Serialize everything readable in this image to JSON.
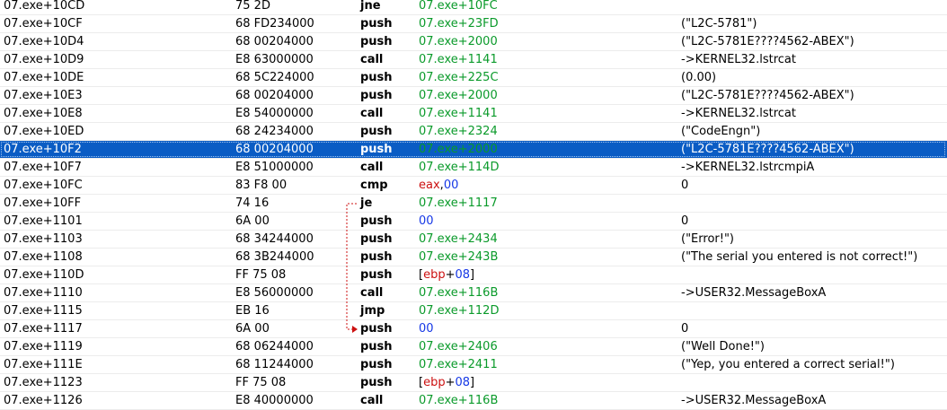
{
  "disassembly": {
    "rows": [
      {
        "addr": "07.exe+10CD",
        "bytes": "75 2D",
        "mnemonic": "jne",
        "operand": [
          {
            "text": "07.exe+10FC",
            "color": "green"
          }
        ],
        "comment": "",
        "selected": false
      },
      {
        "addr": "07.exe+10CF",
        "bytes": "68 FD234000",
        "mnemonic": "push",
        "operand": [
          {
            "text": "07.exe+23FD",
            "color": "green"
          }
        ],
        "comment": "(\"L2C-5781\")",
        "selected": false
      },
      {
        "addr": "07.exe+10D4",
        "bytes": "68 00204000",
        "mnemonic": "push",
        "operand": [
          {
            "text": "07.exe+2000",
            "color": "green"
          }
        ],
        "comment": "(\"L2C-5781E????4562-ABEX\")",
        "selected": false
      },
      {
        "addr": "07.exe+10D9",
        "bytes": "E8 63000000",
        "mnemonic": "call",
        "operand": [
          {
            "text": "07.exe+1141",
            "color": "green"
          }
        ],
        "comment": "->KERNEL32.lstrcat",
        "selected": false
      },
      {
        "addr": "07.exe+10DE",
        "bytes": "68 5C224000",
        "mnemonic": "push",
        "operand": [
          {
            "text": "07.exe+225C",
            "color": "green"
          }
        ],
        "comment": "(0.00)",
        "selected": false
      },
      {
        "addr": "07.exe+10E3",
        "bytes": "68 00204000",
        "mnemonic": "push",
        "operand": [
          {
            "text": "07.exe+2000",
            "color": "green"
          }
        ],
        "comment": "(\"L2C-5781E????4562-ABEX\")",
        "selected": false
      },
      {
        "addr": "07.exe+10E8",
        "bytes": "E8 54000000",
        "mnemonic": "call",
        "operand": [
          {
            "text": "07.exe+1141",
            "color": "green"
          }
        ],
        "comment": "->KERNEL32.lstrcat",
        "selected": false
      },
      {
        "addr": "07.exe+10ED",
        "bytes": "68 24234000",
        "mnemonic": "push",
        "operand": [
          {
            "text": "07.exe+2324",
            "color": "green"
          }
        ],
        "comment": "(\"CodeEngn\")",
        "selected": false
      },
      {
        "addr": "07.exe+10F2",
        "bytes": "68 00204000",
        "mnemonic": "push",
        "operand": [
          {
            "text": "07.exe+2000",
            "color": "green"
          }
        ],
        "comment": "(\"L2C-5781E????4562-ABEX\")",
        "selected": true
      },
      {
        "addr": "07.exe+10F7",
        "bytes": "E8 51000000",
        "mnemonic": "call",
        "operand": [
          {
            "text": "07.exe+114D",
            "color": "green"
          }
        ],
        "comment": "->KERNEL32.lstrcmpiA",
        "selected": false
      },
      {
        "addr": "07.exe+10FC",
        "bytes": "83 F8 00",
        "mnemonic": "cmp",
        "operand": [
          {
            "text": "eax",
            "color": "red"
          },
          {
            "text": ",",
            "color": "black"
          },
          {
            "text": "00",
            "color": "blue"
          }
        ],
        "comment": "0",
        "selected": false
      },
      {
        "addr": "07.exe+10FF",
        "bytes": "74 16",
        "mnemonic": "je",
        "operand": [
          {
            "text": "07.exe+1117",
            "color": "green"
          }
        ],
        "comment": "",
        "selected": false
      },
      {
        "addr": "07.exe+1101",
        "bytes": "6A 00",
        "mnemonic": "push",
        "operand": [
          {
            "text": "00",
            "color": "blue"
          }
        ],
        "comment": "0",
        "selected": false
      },
      {
        "addr": "07.exe+1103",
        "bytes": "68 34244000",
        "mnemonic": "push",
        "operand": [
          {
            "text": "07.exe+2434",
            "color": "green"
          }
        ],
        "comment": "(\"Error!\")",
        "selected": false
      },
      {
        "addr": "07.exe+1108",
        "bytes": "68 3B244000",
        "mnemonic": "push",
        "operand": [
          {
            "text": "07.exe+243B",
            "color": "green"
          }
        ],
        "comment": "(\"The serial you entered is not correct!\")",
        "selected": false
      },
      {
        "addr": "07.exe+110D",
        "bytes": "FF 75 08",
        "mnemonic": "push",
        "operand": [
          {
            "text": "[",
            "color": "black"
          },
          {
            "text": "ebp",
            "color": "red"
          },
          {
            "text": "+",
            "color": "black"
          },
          {
            "text": "08",
            "color": "blue"
          },
          {
            "text": "]",
            "color": "black"
          }
        ],
        "comment": "",
        "selected": false
      },
      {
        "addr": "07.exe+1110",
        "bytes": "E8 56000000",
        "mnemonic": "call",
        "operand": [
          {
            "text": "07.exe+116B",
            "color": "green"
          }
        ],
        "comment": "->USER32.MessageBoxA",
        "selected": false
      },
      {
        "addr": "07.exe+1115",
        "bytes": "EB 16",
        "mnemonic": "jmp",
        "operand": [
          {
            "text": "07.exe+112D",
            "color": "green"
          }
        ],
        "comment": "",
        "selected": false
      },
      {
        "addr": "07.exe+1117",
        "bytes": "6A 00",
        "mnemonic": "push",
        "operand": [
          {
            "text": "00",
            "color": "blue"
          }
        ],
        "comment": "0",
        "selected": false
      },
      {
        "addr": "07.exe+1119",
        "bytes": "68 06244000",
        "mnemonic": "push",
        "operand": [
          {
            "text": "07.exe+2406",
            "color": "green"
          }
        ],
        "comment": "(\"Well Done!\")",
        "selected": false
      },
      {
        "addr": "07.exe+111E",
        "bytes": "68 11244000",
        "mnemonic": "push",
        "operand": [
          {
            "text": "07.exe+2411",
            "color": "green"
          }
        ],
        "comment": "(\"Yep, you entered a correct serial!\")",
        "selected": false
      },
      {
        "addr": "07.exe+1123",
        "bytes": "FF 75 08",
        "mnemonic": "push",
        "operand": [
          {
            "text": "[",
            "color": "black"
          },
          {
            "text": "ebp",
            "color": "red"
          },
          {
            "text": "+",
            "color": "black"
          },
          {
            "text": "08",
            "color": "blue"
          },
          {
            "text": "]",
            "color": "black"
          }
        ],
        "comment": "",
        "selected": false
      },
      {
        "addr": "07.exe+1126",
        "bytes": "E8 40000000",
        "mnemonic": "call",
        "operand": [
          {
            "text": "07.exe+116B",
            "color": "green"
          }
        ],
        "comment": "->USER32.MessageBoxA",
        "selected": false
      }
    ],
    "jump": {
      "from_row": 11,
      "to_row": 18,
      "color": "#cc1111"
    },
    "colors": {
      "selection": "#0a5cc4",
      "address_green": "#0a9a2a",
      "register_red": "#cc1111",
      "immediate_blue": "#1638e6"
    }
  }
}
